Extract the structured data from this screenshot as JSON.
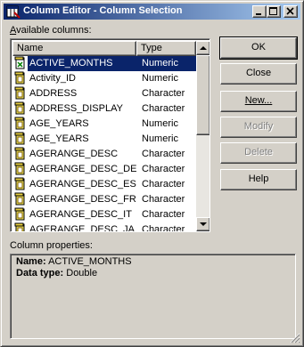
{
  "window": {
    "title": "Column Editor - Column Selection"
  },
  "labels": {
    "available_columns": "Available columns:",
    "column_properties": "Column properties:"
  },
  "columns": {
    "name_header": "Name",
    "type_header": "Type"
  },
  "rows": [
    {
      "name": "ACTIVE_MONTHS",
      "type": "Numeric",
      "selected": true,
      "icon": "calculated-column-icon"
    },
    {
      "name": "Activity_ID",
      "type": "Numeric",
      "icon": "column-icon"
    },
    {
      "name": "ADDRESS",
      "type": "Character",
      "icon": "column-icon"
    },
    {
      "name": "ADDRESS_DISPLAY",
      "type": "Character",
      "icon": "column-icon"
    },
    {
      "name": "AGE_YEARS",
      "type": "Numeric",
      "icon": "column-icon"
    },
    {
      "name": "AGE_YEARS",
      "type": "Numeric",
      "icon": "column-icon"
    },
    {
      "name": "AGERANGE_DESC",
      "type": "Character",
      "icon": "column-icon"
    },
    {
      "name": "AGERANGE_DESC_DE",
      "type": "Character",
      "icon": "column-icon"
    },
    {
      "name": "AGERANGE_DESC_ES",
      "type": "Character",
      "icon": "column-icon"
    },
    {
      "name": "AGERANGE_DESC_FR",
      "type": "Character",
      "icon": "column-icon"
    },
    {
      "name": "AGERANGE_DESC_IT",
      "type": "Character",
      "icon": "column-icon"
    },
    {
      "name": "AGERANGE_DESC_JA",
      "type": "Character",
      "icon": "column-icon"
    }
  ],
  "buttons": {
    "ok": "OK",
    "close": "Close",
    "new": "New...",
    "modify": "Modify",
    "delete": "Delete",
    "help": "Help"
  },
  "properties": {
    "name_label": "Name:",
    "name_value": "ACTIVE_MONTHS",
    "datatype_label": "Data type:",
    "datatype_value": "Double"
  },
  "colors": {
    "selection": "#0a246a",
    "face": "#d4d0c8"
  }
}
